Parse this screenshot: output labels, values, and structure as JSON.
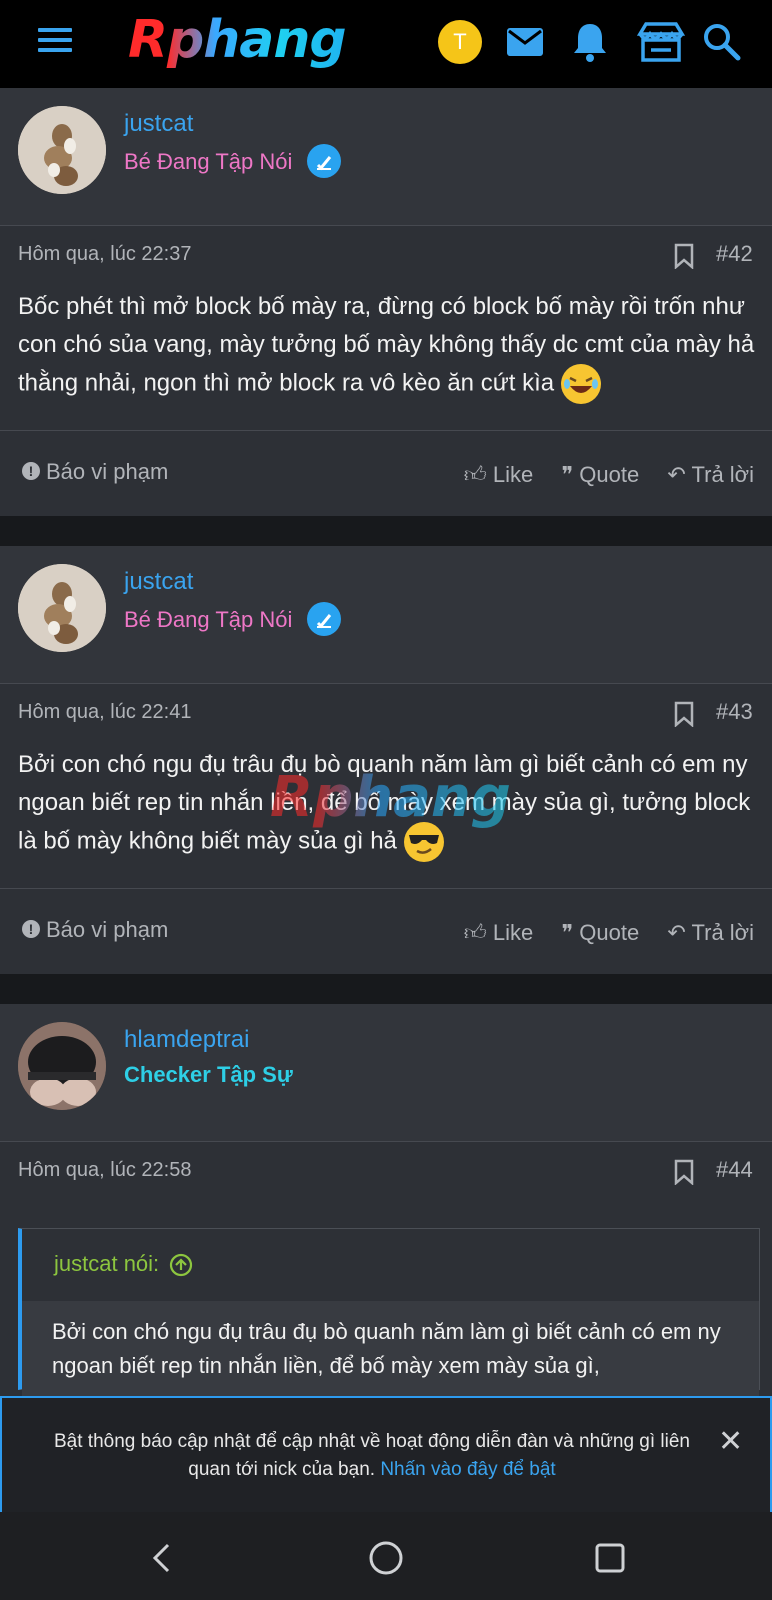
{
  "header": {
    "logo": "Rphang",
    "user_initial": "T",
    "icons": [
      "menu-icon",
      "mail-icon",
      "bell-icon",
      "store-icon",
      "search-icon"
    ]
  },
  "posts": [
    {
      "username": "justcat",
      "user_title": "Bé Đang Tập Nói",
      "time": "Hôm qua, lúc 22:37",
      "number": "#42",
      "body": "Bốc phét thì mở block bố mày ra, đừng có block bố mày rồi trốn như con chó sủa vang, mày tưởng bố mày không thấy dc cmt của mày hả thằng nhải, ngon thì mở block ra vô kèo ăn cứt kìa",
      "emoji": "laughing-emoji"
    },
    {
      "username": "justcat",
      "user_title": "Bé Đang Tập Nói",
      "time": "Hôm qua, lúc 22:41",
      "number": "#43",
      "body": "Bởi con chó ngu đụ trâu đụ bò quanh năm làm gì biết cảnh có em ny ngoan biết rep tin nhắn liền, để bố mày xem mày sủa gì, tưởng block là bố mày không biết mày sủa gì hả",
      "emoji": "sunglasses-emoji"
    },
    {
      "username": "hlamdeptrai",
      "user_title": "Checker Tập Sự",
      "time": "Hôm qua, lúc 22:58",
      "number": "#44",
      "quote_author": "justcat nói:",
      "quote_text": "Bởi con chó ngu đụ trâu đụ bò quanh năm làm gì biết cảnh có em ny ngoan biết rep tin nhắn liền, để bố mày xem mày sủa gì,"
    }
  ],
  "footer_actions": {
    "report": "Báo vi phạm",
    "like": "Like",
    "quote": "Quote",
    "reply": "Trả lời"
  },
  "watermark": "Rphang",
  "notice": {
    "text": "Bật thông báo cập nhật để cập nhật về hoạt động diễn đàn và những gì liên quan tới nick của bạn.",
    "link": "Nhấn vào đây để bật"
  },
  "colors": {
    "accent": "#3aa4ef",
    "pink_title": "#ee77c6",
    "cyan_title": "#2ecfe6",
    "quote_green": "#8dc63f"
  }
}
